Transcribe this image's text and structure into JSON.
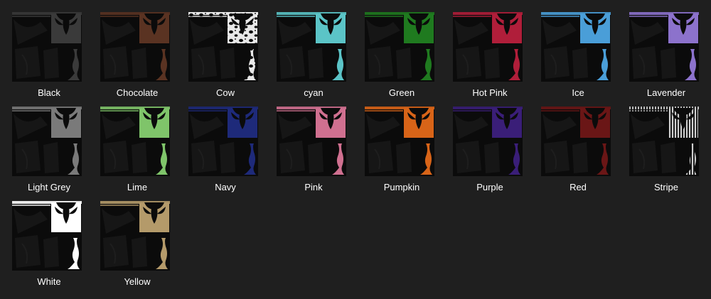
{
  "items": [
    {
      "label": "Black",
      "color": "#3a3a3a",
      "pattern": "solid"
    },
    {
      "label": "Chocolate",
      "color": "#5a3322",
      "pattern": "solid"
    },
    {
      "label": "Cow",
      "color": "#e8e8e8",
      "pattern": "cow"
    },
    {
      "label": "cyan",
      "color": "#5bc4c7",
      "pattern": "solid"
    },
    {
      "label": "Green",
      "color": "#1f7a1f",
      "pattern": "solid"
    },
    {
      "label": "Hot Pink",
      "color": "#b01e3a",
      "pattern": "solid"
    },
    {
      "label": "Ice",
      "color": "#4a9ed8",
      "pattern": "solid"
    },
    {
      "label": "Lavender",
      "color": "#8c72cc",
      "pattern": "solid"
    },
    {
      "label": "Light Grey",
      "color": "#7a7a7a",
      "pattern": "solid"
    },
    {
      "label": "Lime",
      "color": "#7fc46a",
      "pattern": "solid"
    },
    {
      "label": "Navy",
      "color": "#1e2a7a",
      "pattern": "solid"
    },
    {
      "label": "Pink",
      "color": "#d07090",
      "pattern": "solid"
    },
    {
      "label": "Pumpkin",
      "color": "#d86418",
      "pattern": "solid"
    },
    {
      "label": "Purple",
      "color": "#3a1e78",
      "pattern": "solid"
    },
    {
      "label": "Red",
      "color": "#6a1616",
      "pattern": "solid"
    },
    {
      "label": "Stripe",
      "color": "#cfcfcf",
      "pattern": "stripe"
    },
    {
      "label": "White",
      "color": "#ffffff",
      "pattern": "solid"
    },
    {
      "label": "Yellow",
      "color": "#b49a6a",
      "pattern": "solid"
    }
  ]
}
